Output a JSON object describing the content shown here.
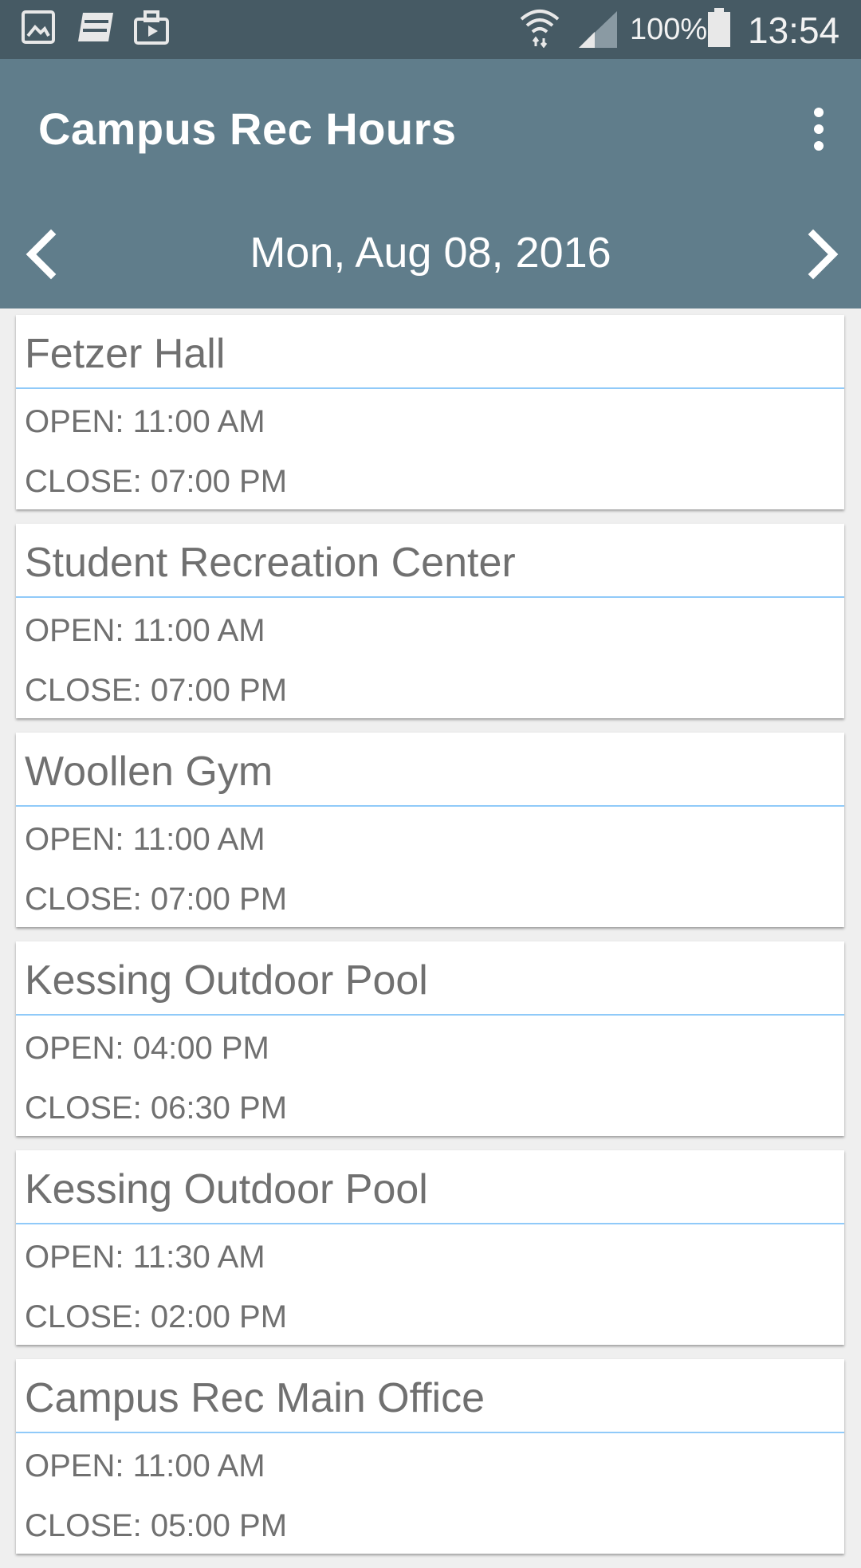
{
  "status_bar": {
    "battery": "100%",
    "time": "13:54",
    "icons": [
      "gallery-icon",
      "news-icon",
      "briefcase-icon",
      "wifi-icon",
      "signal-icon",
      "battery-icon"
    ]
  },
  "app_bar": {
    "title": "Campus Rec Hours",
    "date": "Mon, Aug 08, 2016",
    "icons": [
      "overflow-menu-icon",
      "chevron-left-icon",
      "chevron-right-icon"
    ]
  },
  "colors": {
    "status_bar": "#465a64",
    "app_bar": "#607d8b",
    "divider": "#90caf9",
    "text": "#707070",
    "background": "#efefef"
  },
  "facilities": [
    {
      "name": "Fetzer Hall",
      "open": "OPEN: 11:00 AM",
      "close": "CLOSE: 07:00 PM"
    },
    {
      "name": "Student Recreation Center",
      "open": "OPEN: 11:00 AM",
      "close": "CLOSE: 07:00 PM"
    },
    {
      "name": "Woollen Gym",
      "open": "OPEN: 11:00 AM",
      "close": "CLOSE: 07:00 PM"
    },
    {
      "name": "Kessing Outdoor Pool",
      "open": "OPEN: 04:00 PM",
      "close": "CLOSE: 06:30 PM"
    },
    {
      "name": "Kessing Outdoor Pool",
      "open": "OPEN: 11:30 AM",
      "close": "CLOSE: 02:00 PM"
    },
    {
      "name": "Campus Rec Main Office",
      "open": "OPEN: 11:00 AM",
      "close": "CLOSE: 05:00 PM"
    }
  ]
}
